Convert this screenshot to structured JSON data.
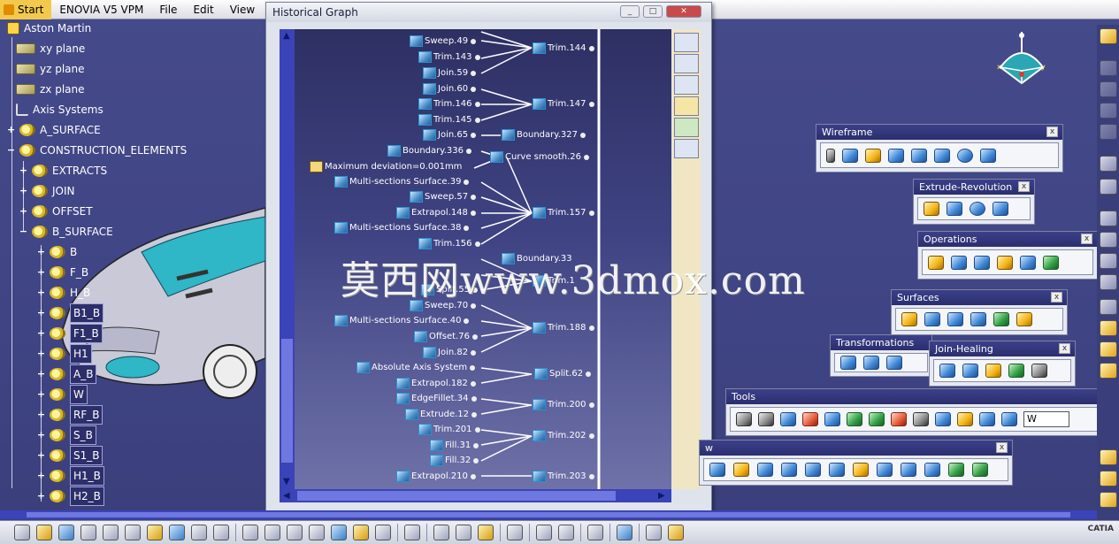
{
  "menubar": {
    "items": [
      "Start",
      "ENOVIA V5 VPM",
      "File",
      "Edit",
      "View"
    ]
  },
  "tree": {
    "root": "Aston Martin",
    "items": [
      {
        "label": "xy plane",
        "icon": "plane-icon"
      },
      {
        "label": "yz plane",
        "icon": "plane-icon"
      },
      {
        "label": "zx plane",
        "icon": "plane-icon"
      },
      {
        "label": "Axis Systems",
        "icon": "axis-icon"
      },
      {
        "label": "A_SURFACE",
        "icon": "geometrical-set-icon"
      },
      {
        "label": "CONSTRUCTION_ELEMENTS",
        "icon": "geometrical-set-icon"
      },
      {
        "label": "EXTRACTS",
        "icon": "geometrical-set-icon"
      },
      {
        "label": "JOIN",
        "icon": "geometrical-set-icon"
      },
      {
        "label": "OFFSET",
        "icon": "geometrical-set-icon"
      },
      {
        "label": "B_SURFACE",
        "icon": "geometrical-set-icon"
      },
      {
        "label": "B",
        "icon": "geometrical-set-icon"
      },
      {
        "label": "F_B",
        "icon": "geometrical-set-icon"
      },
      {
        "label": "H_B",
        "icon": "geometrical-set-icon"
      },
      {
        "label": "B1_B",
        "icon": "geometrical-set-icon",
        "highlighted": true
      },
      {
        "label": "F1_B",
        "icon": "geometrical-set-icon",
        "highlighted": true
      },
      {
        "label": "H1",
        "icon": "geometrical-set-icon",
        "highlighted": true
      },
      {
        "label": "A_B",
        "icon": "geometrical-set-icon",
        "highlighted": true
      },
      {
        "label": "W",
        "icon": "geometrical-set-icon",
        "highlighted": true
      },
      {
        "label": "RF_B",
        "icon": "geometrical-set-icon",
        "highlighted": true
      },
      {
        "label": "S_B",
        "icon": "geometrical-set-icon",
        "highlighted": true
      },
      {
        "label": "S1_B",
        "icon": "geometrical-set-icon",
        "highlighted": true
      },
      {
        "label": "H1_B",
        "icon": "geometrical-set-icon",
        "highlighted": true
      },
      {
        "label": "H2_B",
        "icon": "geometrical-set-icon",
        "highlighted": true
      }
    ]
  },
  "historical_graph": {
    "title": "Historical Graph",
    "nodes_left": [
      "Sweep.49",
      "Trim.143",
      "Join.59",
      "Join.60",
      "Trim.146",
      "Trim.145",
      "Join.65",
      "Boundary.336",
      "Maximum deviation=0.001mm",
      "Multi-sections Surface.39",
      "Sweep.57",
      "Extrapol.148",
      "Multi-sections Surface.38",
      "Trim.156",
      "Split.55",
      "Sweep.70",
      "Multi-sections Surface.40",
      "Offset.76",
      "Join.82",
      "Absolute Axis System",
      "Extrapol.182",
      "EdgeFillet.34",
      "Extrude.12",
      "Trim.201",
      "Fill.31",
      "Fill.32",
      "Extrapol.210"
    ],
    "nodes_right": [
      "Trim.144",
      "Trim.147",
      "Boundary.327",
      "Curve smooth.26",
      "Trim.157",
      "Boundary.33",
      "Trim.1",
      "Trim.188",
      "Split.62",
      "Trim.200",
      "Trim.202",
      "Trim.203"
    ]
  },
  "toolbars": {
    "wireframe": {
      "title": "Wireframe"
    },
    "extrude_revolution": {
      "title": "Extrude-Revolution"
    },
    "operations": {
      "title": "Operations"
    },
    "surfaces": {
      "title": "Surfaces"
    },
    "transformations": {
      "title": "Transformations"
    },
    "join_healing": {
      "title": "Join-Healing"
    },
    "tools": {
      "title": "Tools",
      "field_value": "W"
    },
    "view": {
      "title": "w"
    }
  },
  "watermark": "莫西网www.3dmox.com",
  "brand": "CATIA",
  "colors": {
    "background": "#3f4484",
    "tree_highlight": "#2d2f6b",
    "graph_scroll": "#3b43b8",
    "menubar_start": "#f2c94c"
  }
}
